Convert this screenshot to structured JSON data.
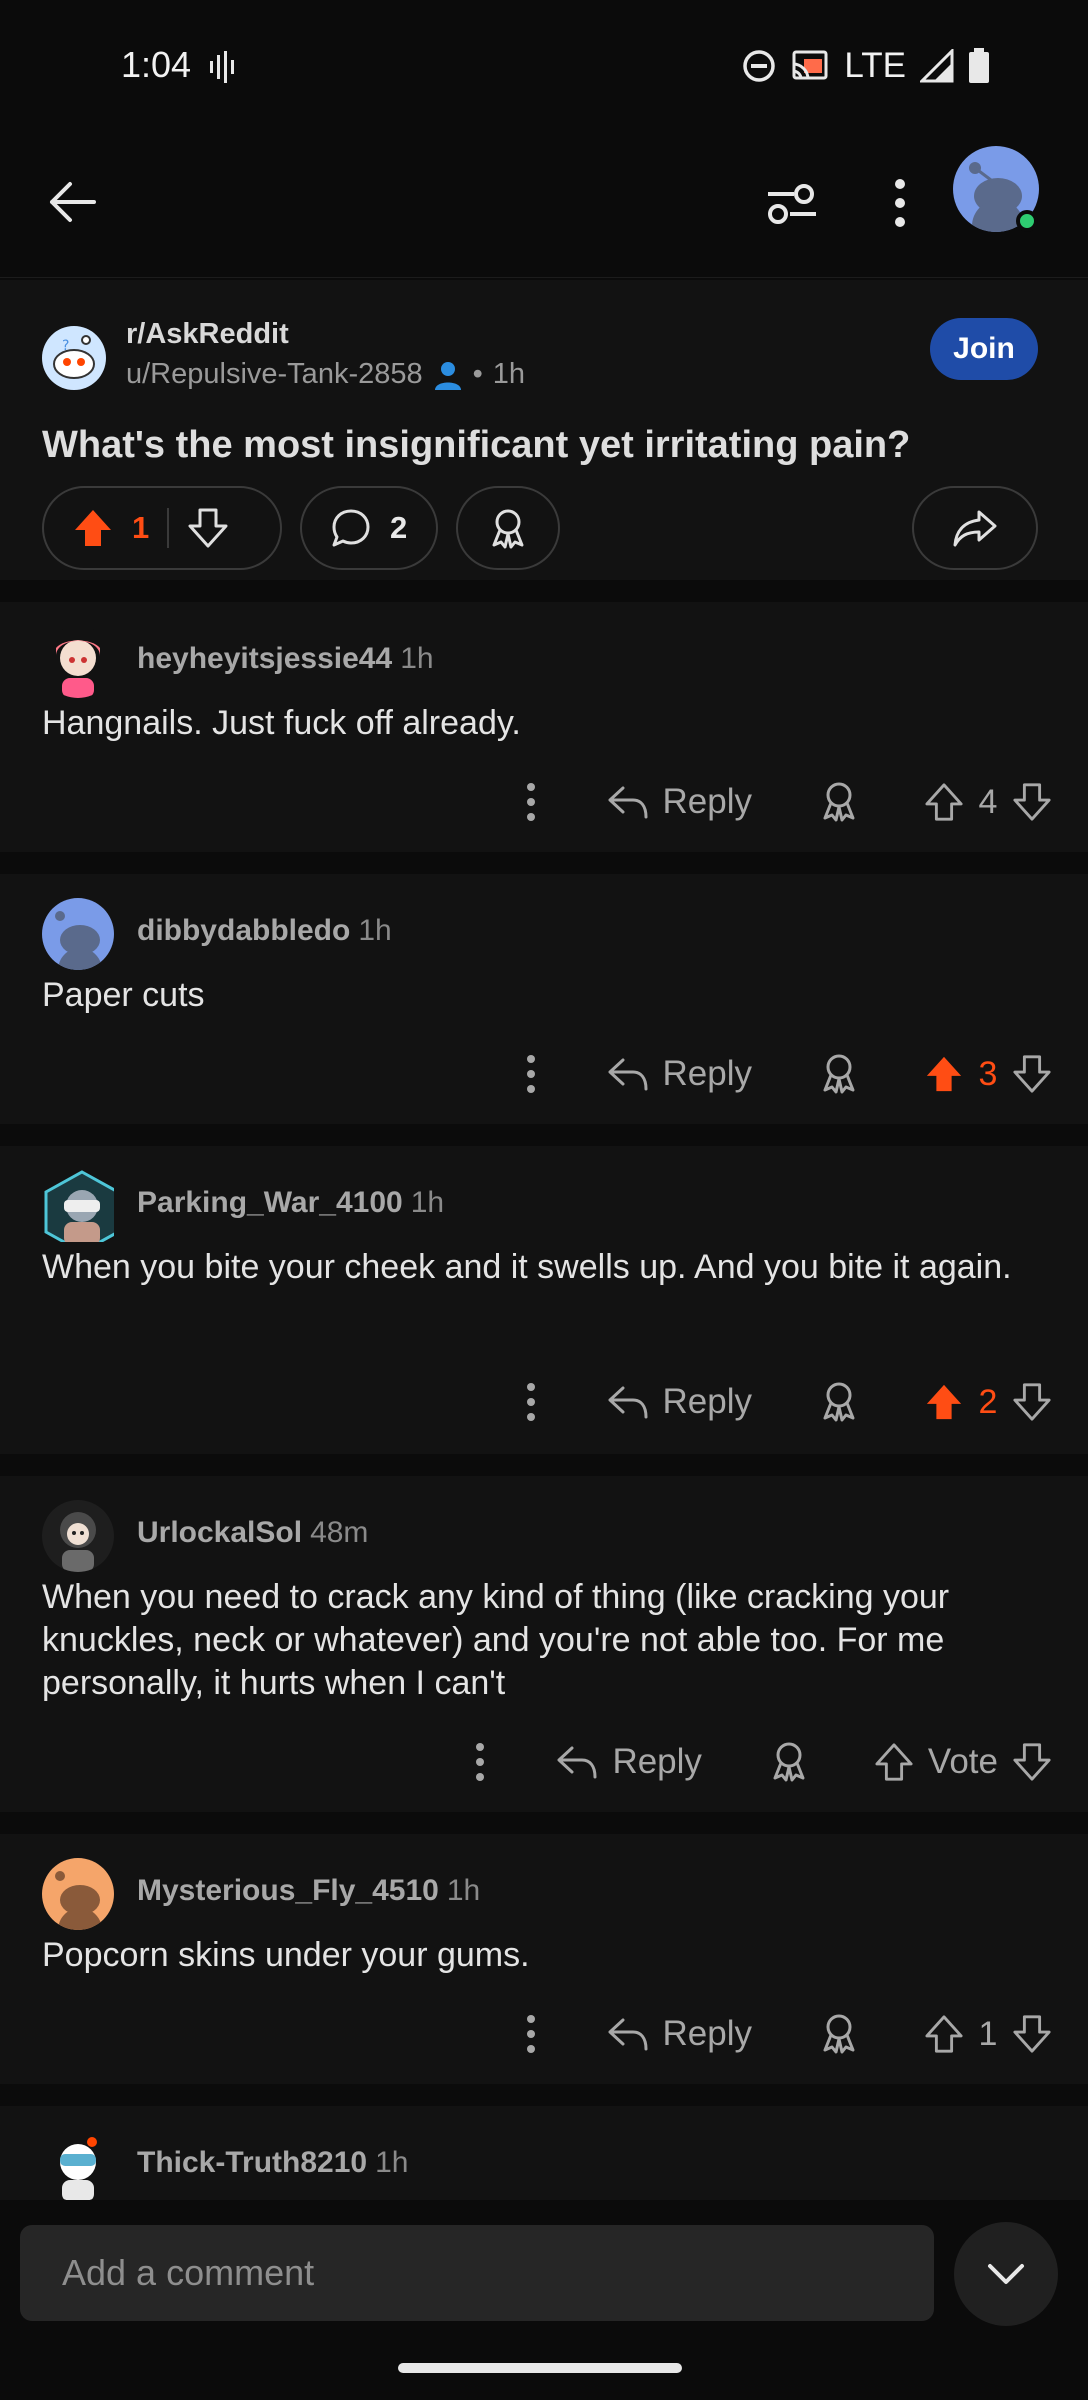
{
  "status_bar": {
    "time": "1:04",
    "network": "LTE"
  },
  "post": {
    "subreddit": "r/AskReddit",
    "author": "u/Repulsive-Tank-2858",
    "age": "1h",
    "join_label": "Join",
    "title": "What's the most insignificant yet irritating pain?",
    "score": "1",
    "comment_count": "2"
  },
  "comments": [
    {
      "user": "heyheyitsjessie44",
      "time": "1h",
      "body": "Hangnails.  Just fuck off already.",
      "reply_label": "Reply",
      "score": "4"
    },
    {
      "user": "dibbydabbledo",
      "time": "1h",
      "body": "Paper cuts",
      "reply_label": "Reply",
      "score": "3"
    },
    {
      "user": "Parking_War_4100",
      "time": "1h",
      "body": "When you bite your cheek and it swells up. And you bite it again.",
      "reply_label": "Reply",
      "score": "2"
    },
    {
      "user": "UrlockalSol",
      "time": "48m",
      "body": "When you need to crack any kind of thing (like cracking your knuckles, neck or whatever) and you're not able too. For me personally, it hurts when I can't",
      "reply_label": "Reply",
      "score": "Vote"
    },
    {
      "user": "Mysterious_Fly_4510",
      "time": "1h",
      "body": "Popcorn skins under your gums.",
      "reply_label": "Reply",
      "score": "1"
    },
    {
      "user": "Thick-Truth8210",
      "time": "1h"
    }
  ],
  "comment_input": {
    "placeholder": "Add a comment"
  },
  "colors": {
    "upvote_active": "#ff4d14",
    "join_bg": "#1f4ca8",
    "background": "#0b0b0b",
    "card": "#121212"
  },
  "icons": [
    "back-arrow-icon",
    "filter-icon",
    "more-vertical-icon",
    "upvote-icon",
    "downvote-icon",
    "comment-icon",
    "award-icon",
    "share-icon",
    "reply-icon",
    "chevron-down-icon"
  ]
}
